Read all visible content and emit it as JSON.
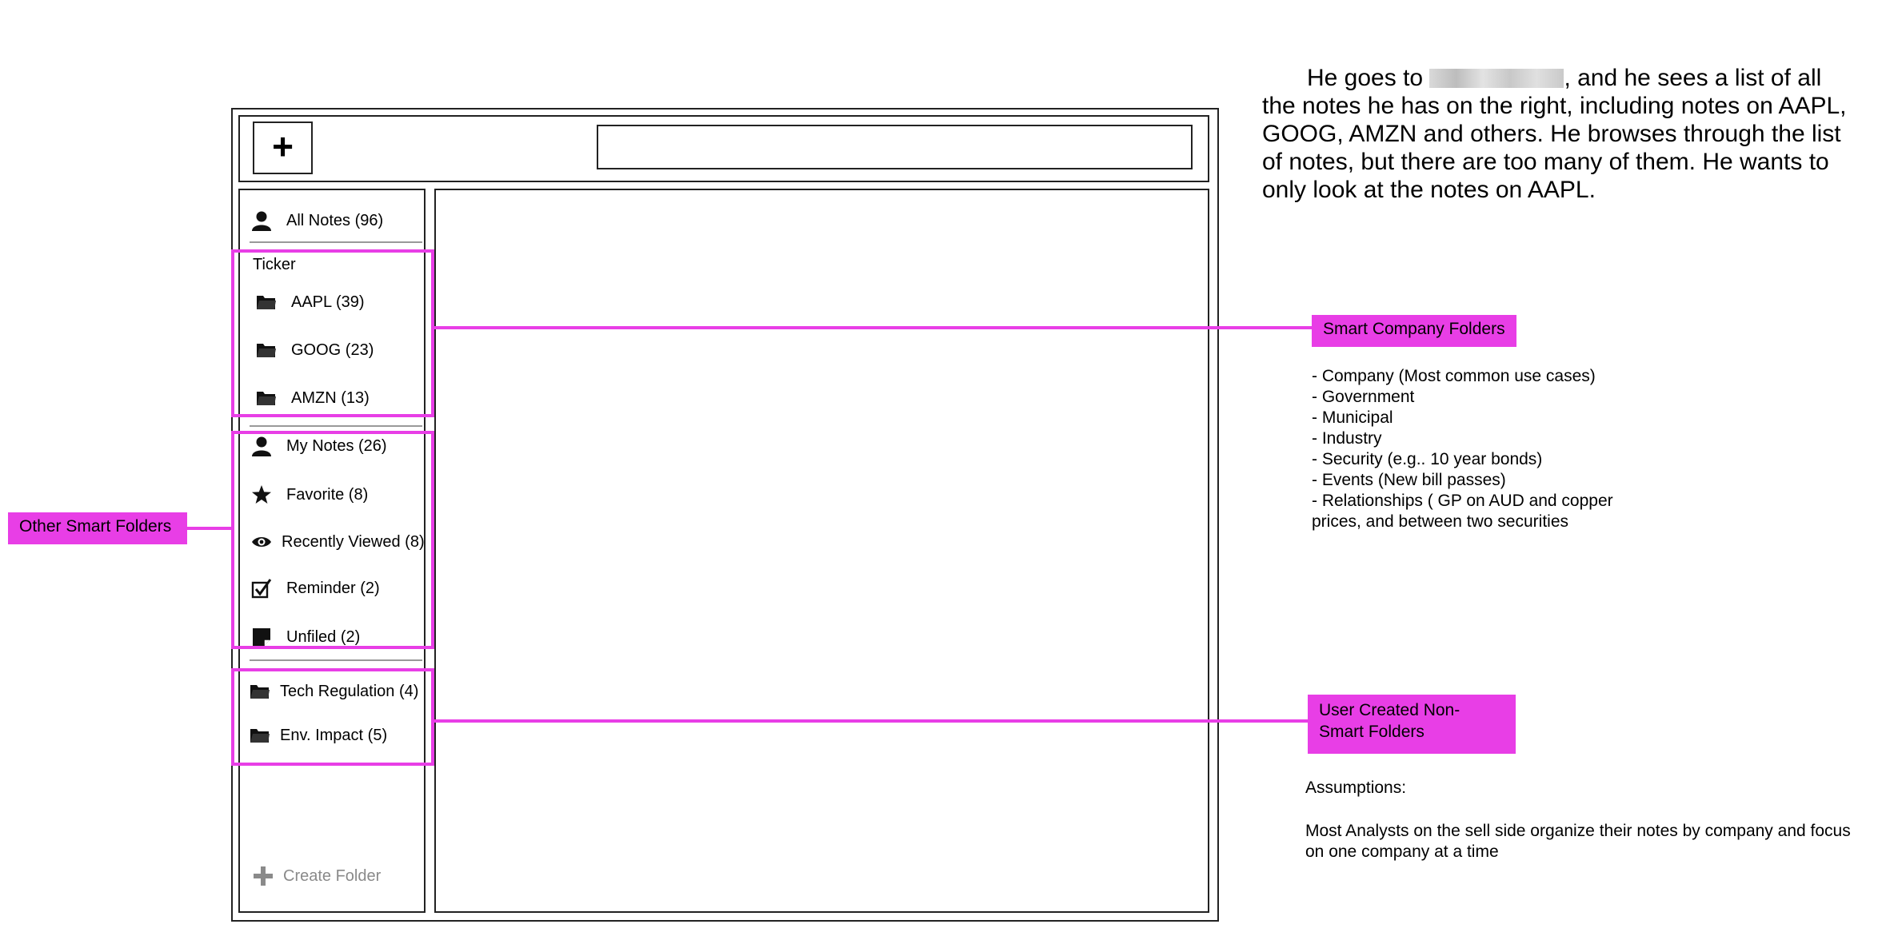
{
  "app": {
    "new_note_button": "+",
    "search": {
      "value": "",
      "placeholder": ""
    },
    "sidebar": {
      "all_notes": "All Notes (96)",
      "ticker_header": "Ticker",
      "tickers": [
        "AAPL (39)",
        "GOOG (23)",
        "AMZN (13)"
      ],
      "smart": [
        "My Notes (26)",
        "Favorite (8)",
        "Recently Viewed (8)",
        "Reminder (2)",
        "Unfiled (2)"
      ],
      "user_folders": [
        "Tech Regulation (4)",
        "Env. Impact (5)"
      ],
      "create_folder": "Create Folder"
    }
  },
  "story": {
    "before": "He goes to ",
    "after": ", and he sees a list of all the notes he has on the right, including notes on AAPL, GOOG, AMZN and others. He browses through the list of notes, but there are too many of them. He wants to only look at the notes on AAPL."
  },
  "annotations": {
    "smart_company_folders": "Smart Company Folders",
    "other_smart_folders": "Other Smart Folders",
    "user_created_folders": "User Created Non-Smart Folders",
    "company_folder_types": "- Company (Most common use cases)\n- Government\n- Municipal\n- Industry\n- Security (e.g.. 10 year bonds)\n- Events (New bill passes)\n- Relationships ( GP on AUD and copper prices, and between two securities",
    "assumptions_title": "Assumptions:",
    "assumptions_body": "Most Analysts on the sell side organize their notes by company and focus on one company at a time"
  },
  "colors": {
    "highlight": "#e83ee6",
    "muted": "#8a8a8a"
  },
  "icons": [
    "plus-icon",
    "person-icon",
    "folder-icon",
    "star-icon",
    "eye-icon",
    "checkbox-icon",
    "note-icon"
  ]
}
